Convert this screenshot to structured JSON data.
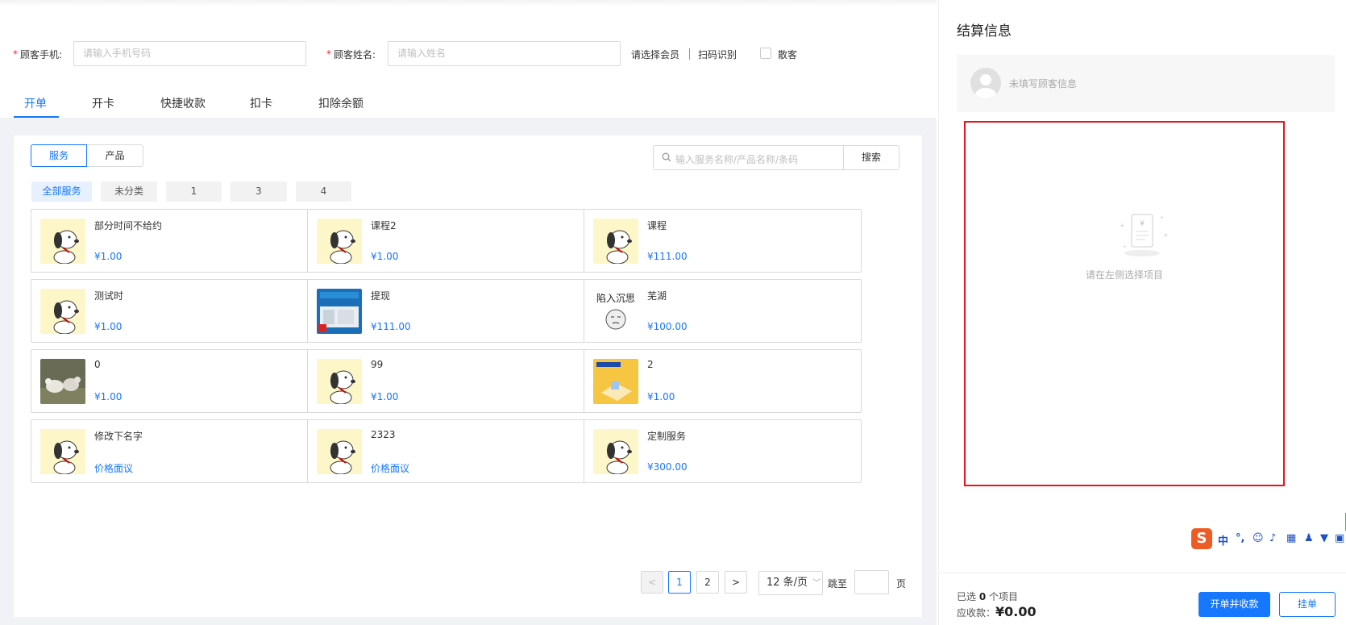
{
  "form": {
    "phone_label": "顾客手机:",
    "phone_placeholder": "请输入手机号码",
    "name_label": "顾客姓名:",
    "name_placeholder": "请输入姓名",
    "required_mark": "*",
    "select_member": "请选择会员",
    "scan_recognize": "扫码识别",
    "walk_in_label": "散客"
  },
  "tabs": [
    "开单",
    "开卡",
    "快捷收款",
    "扣卡",
    "扣除余额"
  ],
  "toggle": {
    "service": "服务",
    "product": "产品"
  },
  "search": {
    "placeholder": "输入服务名称/产品名称/条码",
    "button": "搜索"
  },
  "categories": [
    "全部服务",
    "未分类",
    "1",
    "3",
    "4"
  ],
  "items": [
    {
      "name": "部分时间不给约",
      "price": "¥1.00",
      "thumb": "snoopy"
    },
    {
      "name": "课程2",
      "price": "¥1.00",
      "thumb": "snoopy"
    },
    {
      "name": "课程",
      "price": "¥111.00",
      "thumb": "snoopy"
    },
    {
      "name": "测试时",
      "price": "¥1.00",
      "thumb": "snoopy"
    },
    {
      "name": "提现",
      "price": "¥111.00",
      "thumb": "poster"
    },
    {
      "name": "芜湖",
      "price": "¥100.00",
      "thumb": "meme",
      "thumb_text": "陷入沉思"
    },
    {
      "name": "0",
      "price": "¥1.00",
      "thumb": "sheep"
    },
    {
      "name": "99",
      "price": "¥1.00",
      "thumb": "snoopy"
    },
    {
      "name": "2",
      "price": "¥1.00",
      "thumb": "yellow"
    },
    {
      "name": "修改下名字",
      "price": "价格面议",
      "thumb": "snoopy"
    },
    {
      "name": "2323",
      "price": "价格面议",
      "thumb": "snoopy"
    },
    {
      "name": "定制服务",
      "price": "¥300.00",
      "thumb": "snoopy"
    }
  ],
  "pagination": {
    "prev": "<",
    "next": ">",
    "pages": [
      "1",
      "2"
    ],
    "current_page": "1",
    "page_size": "12 条/页",
    "jump_label": "跳至",
    "page_suffix": "页"
  },
  "settlement": {
    "title": "结算信息",
    "customer_placeholder": "未填写顾客信息",
    "empty_text": "请在左侧选择项目",
    "selected_prefix": "已选",
    "selected_count": "0",
    "selected_suffix": "个项目",
    "due_label": "应收款：",
    "due_amount": "¥0.00",
    "pay_button": "开单并收款",
    "hang_button": "挂单"
  },
  "ime": {
    "logo": "S",
    "mode": "中"
  },
  "colors": {
    "accent": "#1677ff",
    "required": "#f5222d",
    "highlight_border": "#e8131b"
  }
}
